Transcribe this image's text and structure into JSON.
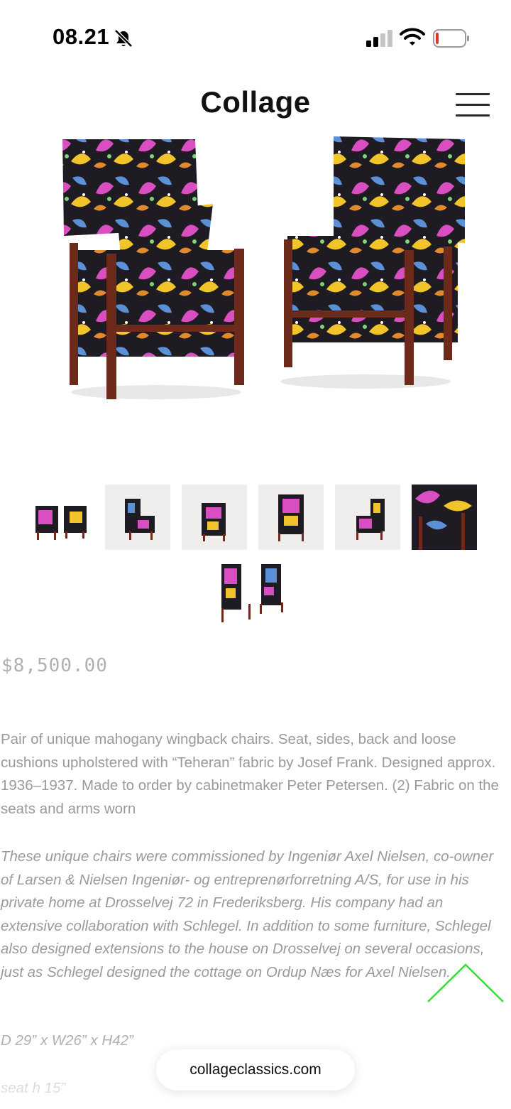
{
  "status_bar": {
    "time": "08.21"
  },
  "header": {
    "logo": "Collage"
  },
  "product": {
    "price": "$8,500.00",
    "description": "Pair of unique mahogany wingback chairs. Seat, sides, back and loose cushions upholstered with “Teheran” fabric by Josef Frank. Designed approx. 1936–1937. Made to order by cabinetmaker Peter Petersen. (2) Fabric on the seats and arms worn",
    "story": "These unique chairs were commissioned by Ingeniør Axel Nielsen, co-owner of Larsen & Nielsen Ingeniør- og entreprenørforretning A/S, for use in his private home at Drosselvej 72 in Frederiksberg. His company had an extensive collaboration with Schlegel. In addition to some furniture, Schlegel also designed extensions to the house on Drosselvej on several occasions, just as Schlegel designed the cottage on Ordup Næs for Axel Nielsen.",
    "dimensions": "D 29” x W26” x H42”",
    "seat_height": "seat h 15”"
  },
  "browser": {
    "url": "collageclassics.com"
  },
  "colors": {
    "accent_arrow": "#33e033",
    "text_gray": "#9a9a9a",
    "upholstery_dark": "#1e1b22",
    "wood": "#6b2a1a"
  },
  "icons": [
    "bell-slash-icon",
    "cellular-signal-icon",
    "wifi-icon",
    "battery-icon",
    "hamburger-menu-icon",
    "chevron-up-icon"
  ]
}
